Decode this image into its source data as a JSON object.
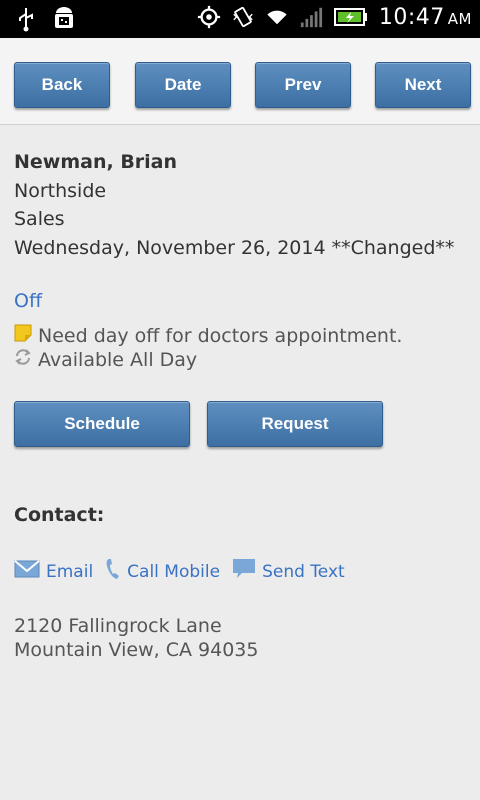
{
  "status_bar": {
    "time": "10:47",
    "ampm": "AM"
  },
  "toolbar": {
    "back_label": "Back",
    "date_label": "Date",
    "prev_label": "Prev",
    "next_label": "Next"
  },
  "employee": {
    "name": "Newman, Brian",
    "location": "Northside",
    "department": "Sales",
    "date_line": "Wednesday, November 26, 2014 **Changed**"
  },
  "shift": {
    "status": "Off",
    "note": "Need day off for doctors appointment.",
    "availability": "Available All Day"
  },
  "actions": {
    "schedule_label": "Schedule",
    "request_label": "Request"
  },
  "contact": {
    "header": "Contact:",
    "email_label": "Email",
    "call_label": "Call Mobile",
    "text_label": "Send Text",
    "address_line1": "2120 Fallingrock Lane",
    "address_line2": "Mountain View, CA 94035"
  },
  "colors": {
    "button": "#4a7db3",
    "link": "#3a72c4",
    "background": "#ececec"
  }
}
